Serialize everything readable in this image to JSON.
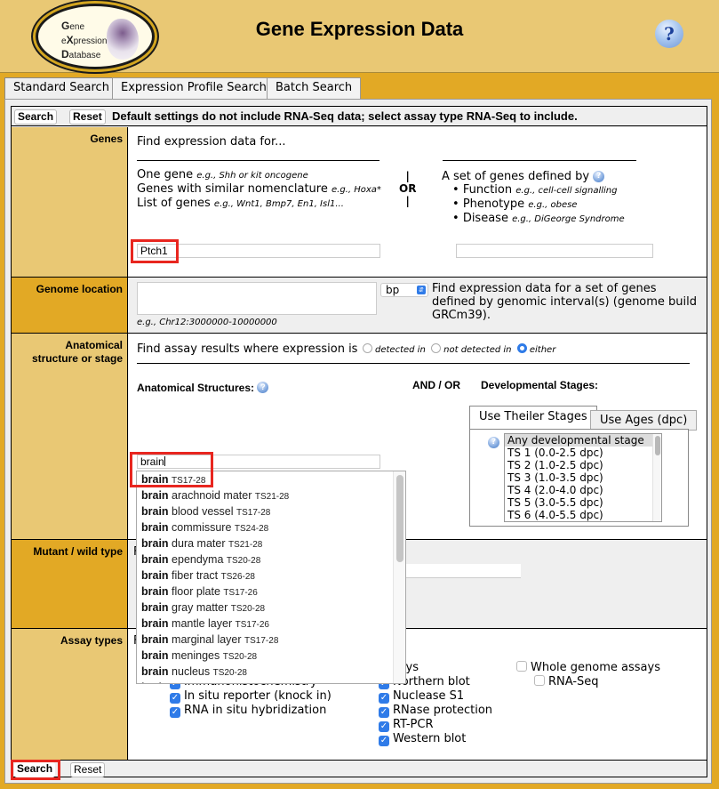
{
  "header": {
    "title": "Gene Expression Data",
    "logo": {
      "line1_initial": "G",
      "line1_rest": "ene",
      "line2_pre": "e",
      "line2_initial": "X",
      "line2_rest": "pression",
      "line3_initial": "D",
      "line3_rest": "atabase"
    },
    "help_icon": "?"
  },
  "tabs": [
    {
      "label": "Standard Search",
      "active": true
    },
    {
      "label": "Expression Profile Search",
      "active": false
    },
    {
      "label": "Batch Search",
      "active": false
    }
  ],
  "topbar": {
    "search_label": "Search",
    "reset_label": "Reset",
    "notice": "Default settings do not include RNA-Seq data; select assay type RNA-Seq to include."
  },
  "genes": {
    "label": "Genes",
    "intro": "Find expression data for...",
    "left_lines": [
      {
        "text": "One gene ",
        "eg": "e.g., Shh or kit oncogene"
      },
      {
        "text": "Genes with similar nomenclature ",
        "eg": "e.g., Hoxa*"
      },
      {
        "text": "List of genes ",
        "eg": "e.g., Wnt1, Bmp7, En1, Isl1..."
      }
    ],
    "or_bar": "|",
    "or_label": "OR",
    "right_intro": "A set of genes defined by",
    "right_items": [
      {
        "text": "Function ",
        "eg": "e.g., cell-cell signalling"
      },
      {
        "text": "Phenotype ",
        "eg": "e.g., obese"
      },
      {
        "text": "Disease ",
        "eg": "e.g., DiGeorge Syndrome"
      }
    ],
    "gene_input_value": "Ptch1",
    "vocab_input_value": ""
  },
  "genome_location": {
    "label": "Genome location",
    "textarea_value": "",
    "unit_selected": "bp",
    "description": "Find expression data for a set of genes defined by genomic interval(s) (genome build GRCm39).",
    "example": "e.g., Chr12:3000000-10000000"
  },
  "anatomy": {
    "label_line1": "Anatomical",
    "label_line2": "structure or stage",
    "prompt": "Find assay results where expression is",
    "options": [
      {
        "label": "detected in",
        "selected": false
      },
      {
        "label": "not detected in",
        "selected": false
      },
      {
        "label": "either",
        "selected": true
      }
    ],
    "structures_label": "Anatomical Structures:",
    "and_or": "AND / OR",
    "stages_label": "Developmental Stages:",
    "structure_input_value": "brain",
    "stage_tabs": [
      {
        "label": "Use Theiler Stages",
        "active": true
      },
      {
        "label": "Use Ages (dpc)",
        "active": false
      }
    ],
    "stages": [
      {
        "label": "Any developmental stage",
        "selected": true
      },
      {
        "label": "TS 1 (0.0-2.5 dpc)",
        "selected": false
      },
      {
        "label": "TS 2 (1.0-2.5 dpc)",
        "selected": false
      },
      {
        "label": "TS 3 (1.0-3.5 dpc)",
        "selected": false
      },
      {
        "label": "TS 4 (2.0-4.0 dpc)",
        "selected": false
      },
      {
        "label": "TS 5 (3.0-5.5 dpc)",
        "selected": false
      },
      {
        "label": "TS 6 (4.0-5.5 dpc)",
        "selected": false
      }
    ]
  },
  "autocomplete": [
    {
      "bold": "brain",
      "rest": "",
      "ts": "TS17-28"
    },
    {
      "bold": "brain",
      "rest": " arachnoid mater",
      "ts": "TS21-28"
    },
    {
      "bold": "brain",
      "rest": " blood vessel",
      "ts": "TS17-28"
    },
    {
      "bold": "brain",
      "rest": " commissure",
      "ts": "TS24-28"
    },
    {
      "bold": "brain",
      "rest": " dura mater",
      "ts": "TS21-28"
    },
    {
      "bold": "brain",
      "rest": " ependyma",
      "ts": "TS20-28"
    },
    {
      "bold": "brain",
      "rest": " fiber tract",
      "ts": "TS26-28"
    },
    {
      "bold": "brain",
      "rest": " floor plate",
      "ts": "TS17-26"
    },
    {
      "bold": "brain",
      "rest": " gray matter",
      "ts": "TS20-28"
    },
    {
      "bold": "brain",
      "rest": " mantle layer",
      "ts": "TS17-26"
    },
    {
      "bold": "brain",
      "rest": " marginal layer",
      "ts": "TS17-28"
    },
    {
      "bold": "brain",
      "rest": " meninges",
      "ts": "TS20-28"
    },
    {
      "bold": "brain",
      "rest": " nucleus",
      "ts": "TS20-28"
    },
    {
      "bold": "brain",
      "rest": " ",
      "ts": ""
    }
  ],
  "mutant": {
    "label": "Mutant / wild type",
    "partial_text": "F"
  },
  "assays": {
    "label": "Assay types",
    "partial_text": "F",
    "middle_heading_partial": "ssays",
    "left": [
      {
        "label": "Immunohistochemistry",
        "checked": true
      },
      {
        "label": "In situ reporter (knock in)",
        "checked": true
      },
      {
        "label": "RNA in situ hybridization",
        "checked": true
      }
    ],
    "middle": [
      {
        "label": "Northern blot",
        "checked": true
      },
      {
        "label": "Nuclease S1",
        "checked": true
      },
      {
        "label": "RNase protection",
        "checked": true
      },
      {
        "label": "RT-PCR",
        "checked": true
      },
      {
        "label": "Western blot",
        "checked": true
      }
    ],
    "whole_genome": {
      "label": "Whole genome assays",
      "checked": false
    },
    "rna_seq": {
      "label": "RNA-Seq",
      "checked": false
    }
  },
  "bottombar": {
    "search_label": "Search",
    "reset_label": "Reset"
  },
  "colors": {
    "header_bg": "#e9c874",
    "accent_gold": "#e2a925",
    "highlight_red": "#e8261f",
    "checkbox_blue": "#2f7be8"
  }
}
